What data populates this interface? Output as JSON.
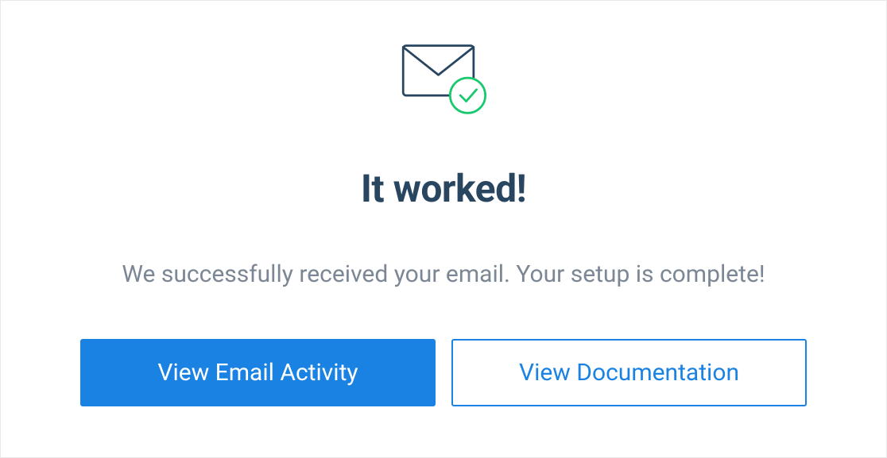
{
  "heading": "It worked!",
  "subtext": "We successfully received your email. Your setup is complete!",
  "buttons": {
    "primary": "View Email Activity",
    "secondary": "View Documentation"
  },
  "colors": {
    "accent": "#1a82e2",
    "heading": "#294661",
    "subtext": "#7b8794",
    "success": "#18c96e",
    "iconStroke": "#294661"
  }
}
